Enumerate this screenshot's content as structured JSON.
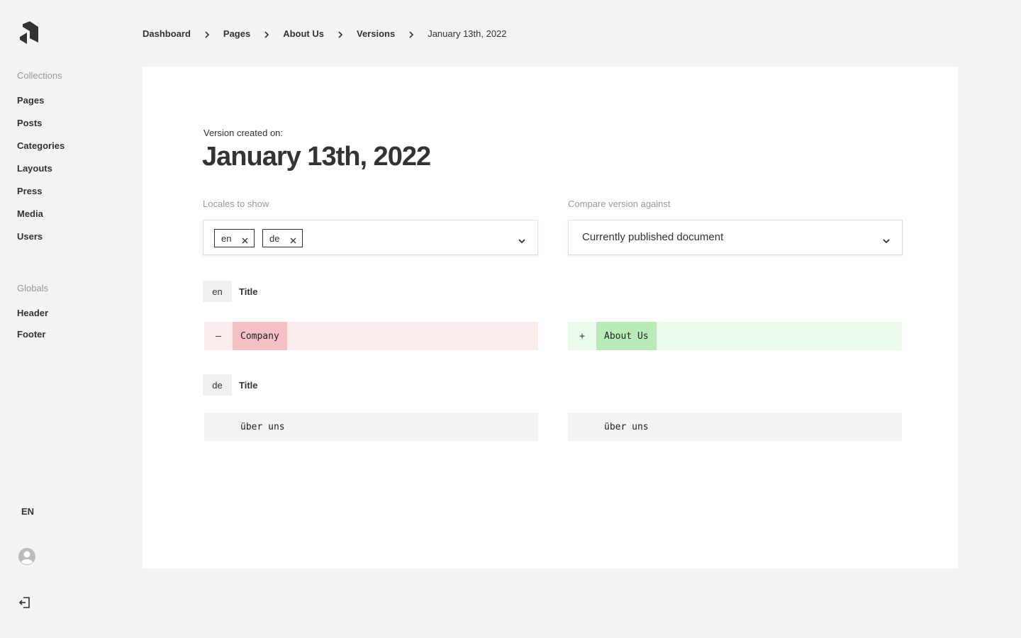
{
  "sidebar": {
    "logo_icon": "payload-logo-icon",
    "collections_label": "Collections",
    "collections": [
      "Pages",
      "Posts",
      "Categories",
      "Layouts",
      "Press",
      "Media",
      "Users"
    ],
    "globals_label": "Globals",
    "globals": [
      "Header",
      "Footer"
    ],
    "language": "EN",
    "avatar_icon": "user-avatar-icon",
    "logout_icon": "logout-icon"
  },
  "breadcrumb": {
    "items": [
      "Dashboard",
      "Pages",
      "About Us",
      "Versions"
    ],
    "current": "January 13th, 2022"
  },
  "version": {
    "created_label": "Version created on:",
    "date": "January 13th, 2022"
  },
  "locales": {
    "label": "Locales to show",
    "selected": [
      "en",
      "de"
    ]
  },
  "compare": {
    "label": "Compare version against",
    "value": "Currently published document"
  },
  "diffs": [
    {
      "locale": "en",
      "field": "Title",
      "removed_sign": "–",
      "removed": "Company",
      "added_sign": "+",
      "added": "About Us"
    },
    {
      "locale": "de",
      "field": "Title",
      "left": "über uns",
      "right": "über uns"
    }
  ],
  "colors": {
    "background": "#f3f3f3",
    "card": "#ffffff",
    "removed_row": "#fcebeb",
    "removed_chunk": "#f5c0c5",
    "added_row": "#ebfbeb",
    "added_chunk": "#b9ebb9",
    "unchanged_row": "#f3f3f3",
    "text": "#333333"
  }
}
